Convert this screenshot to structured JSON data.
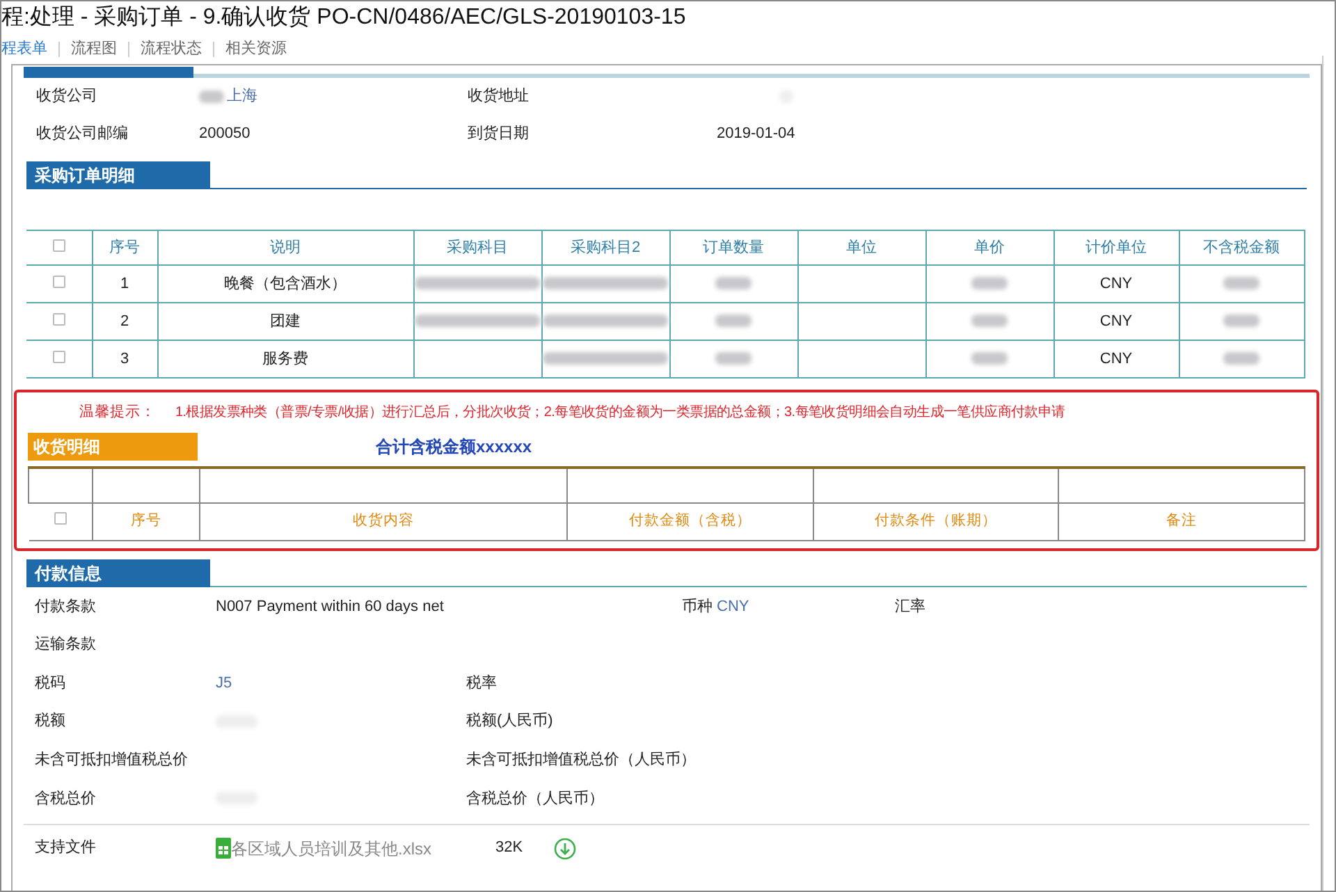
{
  "window": {
    "title": "程:处理 - 采购订单 - 9.确认收货 PO-CN/0486/AEC/GLS-20190103-15"
  },
  "tabs": [
    {
      "label": "程表单",
      "selected": true
    },
    {
      "label": "流程图",
      "selected": false
    },
    {
      "label": "流程状态",
      "selected": false
    },
    {
      "label": "相关资源",
      "selected": false
    }
  ],
  "receipt_info": [
    {
      "label": "收货公司",
      "value": "上海",
      "blurred_prefix": true,
      "label2": "收货地址",
      "value2_blurred": true
    },
    {
      "label": "收货公司邮编",
      "value": "200050",
      "blurred_prefix": false,
      "label2": "到货日期",
      "value2": "2019-01-04"
    }
  ],
  "order_section": {
    "title": "采购订单明细",
    "header_checked": false,
    "columns": [
      "序号",
      "说明",
      "采购科目",
      "采购科目2",
      "订单数量",
      "单位",
      "单价",
      "计价单位",
      "不含税金额"
    ],
    "rows": [
      {
        "checked": false,
        "cells": [
          {
            "kind": "text",
            "text": "1"
          },
          {
            "kind": "text",
            "text": "晚餐（包含酒水）"
          },
          {
            "kind": "blurred"
          },
          {
            "kind": "blurred"
          },
          {
            "kind": "blurred"
          },
          {
            "kind": "empty"
          },
          {
            "kind": "blurred"
          },
          {
            "kind": "text",
            "text": "CNY"
          },
          {
            "kind": "blurred"
          }
        ]
      },
      {
        "checked": false,
        "cells": [
          {
            "kind": "text",
            "text": "2"
          },
          {
            "kind": "text",
            "text": "团建"
          },
          {
            "kind": "blurred"
          },
          {
            "kind": "blurred"
          },
          {
            "kind": "blurred"
          },
          {
            "kind": "empty"
          },
          {
            "kind": "blurred"
          },
          {
            "kind": "text",
            "text": "CNY"
          },
          {
            "kind": "blurred"
          }
        ]
      },
      {
        "checked": false,
        "cells": [
          {
            "kind": "text",
            "text": "3"
          },
          {
            "kind": "text",
            "text": "服务费"
          },
          {
            "kind": "empty"
          },
          {
            "kind": "blurred"
          },
          {
            "kind": "blurred"
          },
          {
            "kind": "empty"
          },
          {
            "kind": "blurred"
          },
          {
            "kind": "text",
            "text": "CNY"
          },
          {
            "kind": "blurred"
          }
        ]
      }
    ]
  },
  "notice": {
    "label": "温馨提示：",
    "text": "1.根据发票种类（普票/专票/收据）进行汇总后，分批次收货；2.每笔收货的金额为一类票据的总金额；3.每笔收货明细会自动生成一笔供应商付款申请"
  },
  "receipt_section": {
    "title": "收货明细",
    "total": "合计含税金额xxxxxx",
    "header_checked": false,
    "columns": [
      "序号",
      "收货内容",
      "付款金额（含税）",
      "付款条件（账期）",
      "备注"
    ]
  },
  "payment_section": {
    "title": "付款信息",
    "rows": [
      {
        "kind": "terms",
        "label": "付款条款",
        "value": "N007 Payment within 60 days net",
        "currency_label": "币种",
        "currency": "CNY",
        "rate_label": "汇率"
      },
      {
        "kind": "single",
        "label": "运输条款"
      },
      {
        "kind": "pair",
        "label": "税码",
        "value": "J5",
        "label2": "税率"
      },
      {
        "kind": "pair",
        "label": "税额",
        "blurred": true,
        "label2": "税额(人民币)"
      },
      {
        "kind": "pair",
        "label": "未含可抵扣增值税总价",
        "label2": "未含可抵扣增值税总价（人民币）"
      },
      {
        "kind": "pair",
        "label": "含税总价",
        "blurred": true,
        "label2": "含税总价（人民币）"
      }
    ],
    "file": {
      "label": "支持文件",
      "name": "各区域人员培训及其他.xlsx",
      "size": "32K"
    }
  }
}
